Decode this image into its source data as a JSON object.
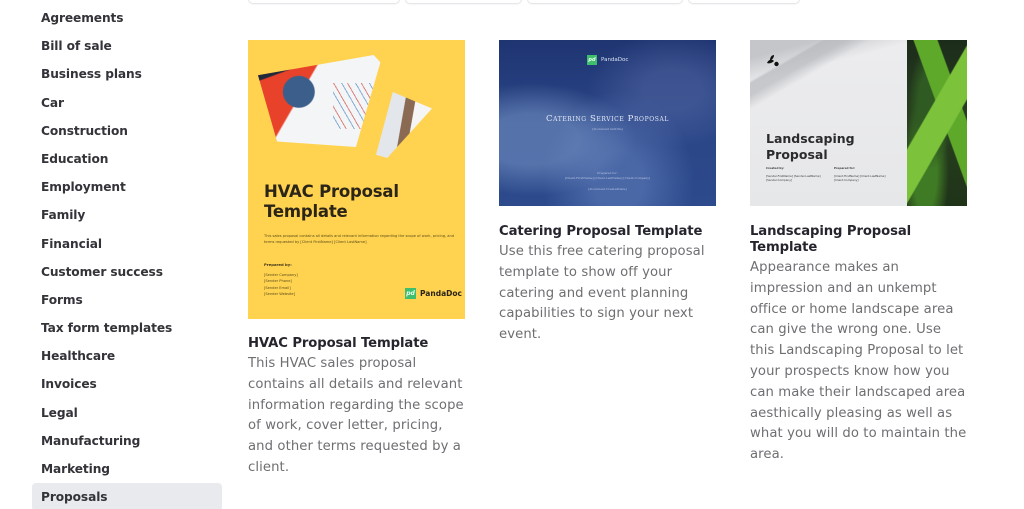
{
  "sidebar": {
    "items": [
      {
        "label": "Agreements",
        "active": false
      },
      {
        "label": "Bill of sale",
        "active": false
      },
      {
        "label": "Business plans",
        "active": false
      },
      {
        "label": "Car",
        "active": false
      },
      {
        "label": "Construction",
        "active": false
      },
      {
        "label": "Education",
        "active": false
      },
      {
        "label": "Employment",
        "active": false
      },
      {
        "label": "Family",
        "active": false
      },
      {
        "label": "Financial",
        "active": false
      },
      {
        "label": "Customer success",
        "active": false
      },
      {
        "label": "Forms",
        "active": false
      },
      {
        "label": "Tax form templates",
        "active": false
      },
      {
        "label": "Healthcare",
        "active": false
      },
      {
        "label": "Invoices",
        "active": false
      },
      {
        "label": "Legal",
        "active": false
      },
      {
        "label": "Manufacturing",
        "active": false
      },
      {
        "label": "Marketing",
        "active": false
      },
      {
        "label": "Proposals",
        "active": true
      }
    ]
  },
  "colors": {
    "active_bg": "#e8eaed",
    "hvac_bg": "#ffd34f",
    "catering_bg": "#2b4687",
    "pandadoc_green": "#3fbf6e"
  },
  "cards": [
    {
      "title": "HVAC Proposal Template",
      "description": "This HVAC sales proposal contains all details and relevant information regarding the scope of work, cover letter, pricing, and other terms requested by a client.",
      "thumbnail": {
        "heading_line1": "HVAC Proposal",
        "heading_line2": "Template",
        "subtitle": "This sales proposal contains all details and relevant information regarding the scope of work, pricing, and terms requested by [Client FirstName] [Client LastName]",
        "prepared_by": "Prepared by:",
        "fields": [
          "[Sender Company]",
          "[Sender Phone]",
          "[Sender Email]",
          "[Sender Website]"
        ],
        "logo_mark": "pd",
        "logo_text": "PandaDoc"
      }
    },
    {
      "title": "Catering Proposal Template",
      "description": "Use this free catering proposal template to show off your catering and event planning capabilities to sign your next event.",
      "thumbnail": {
        "logo_mark": "pd",
        "logo_text": "PandaDoc",
        "heading": "Catering Service Proposal",
        "subtitle": "[Document subtitle]",
        "prepared_for": "Prepared for:",
        "client_fields": "[Client.FirstName] [Client.LastName] [Client.Company]",
        "date": "[Document.CreatedDate]"
      }
    },
    {
      "title": "Landscaping Proposal Template",
      "description": "Appearance makes an impression and an unkempt office or home landscape area can give the wrong one. Use this Landscaping Proposal to let your prospects know how you can make their landscaped area aesthically pleasing as well as what you will do to maintain the area.",
      "thumbnail": {
        "heading_line1": "Landscaping",
        "heading_line2": "Proposal",
        "created_by": "Created by:",
        "created_fields": "[Sender.FirstName] [Sender.LastName] [Sender.Company]",
        "prepared_for": "Prepared for:",
        "prepared_fields": "[Client.FirstName] [Client.LastName] [Client.Company]"
      }
    }
  ]
}
